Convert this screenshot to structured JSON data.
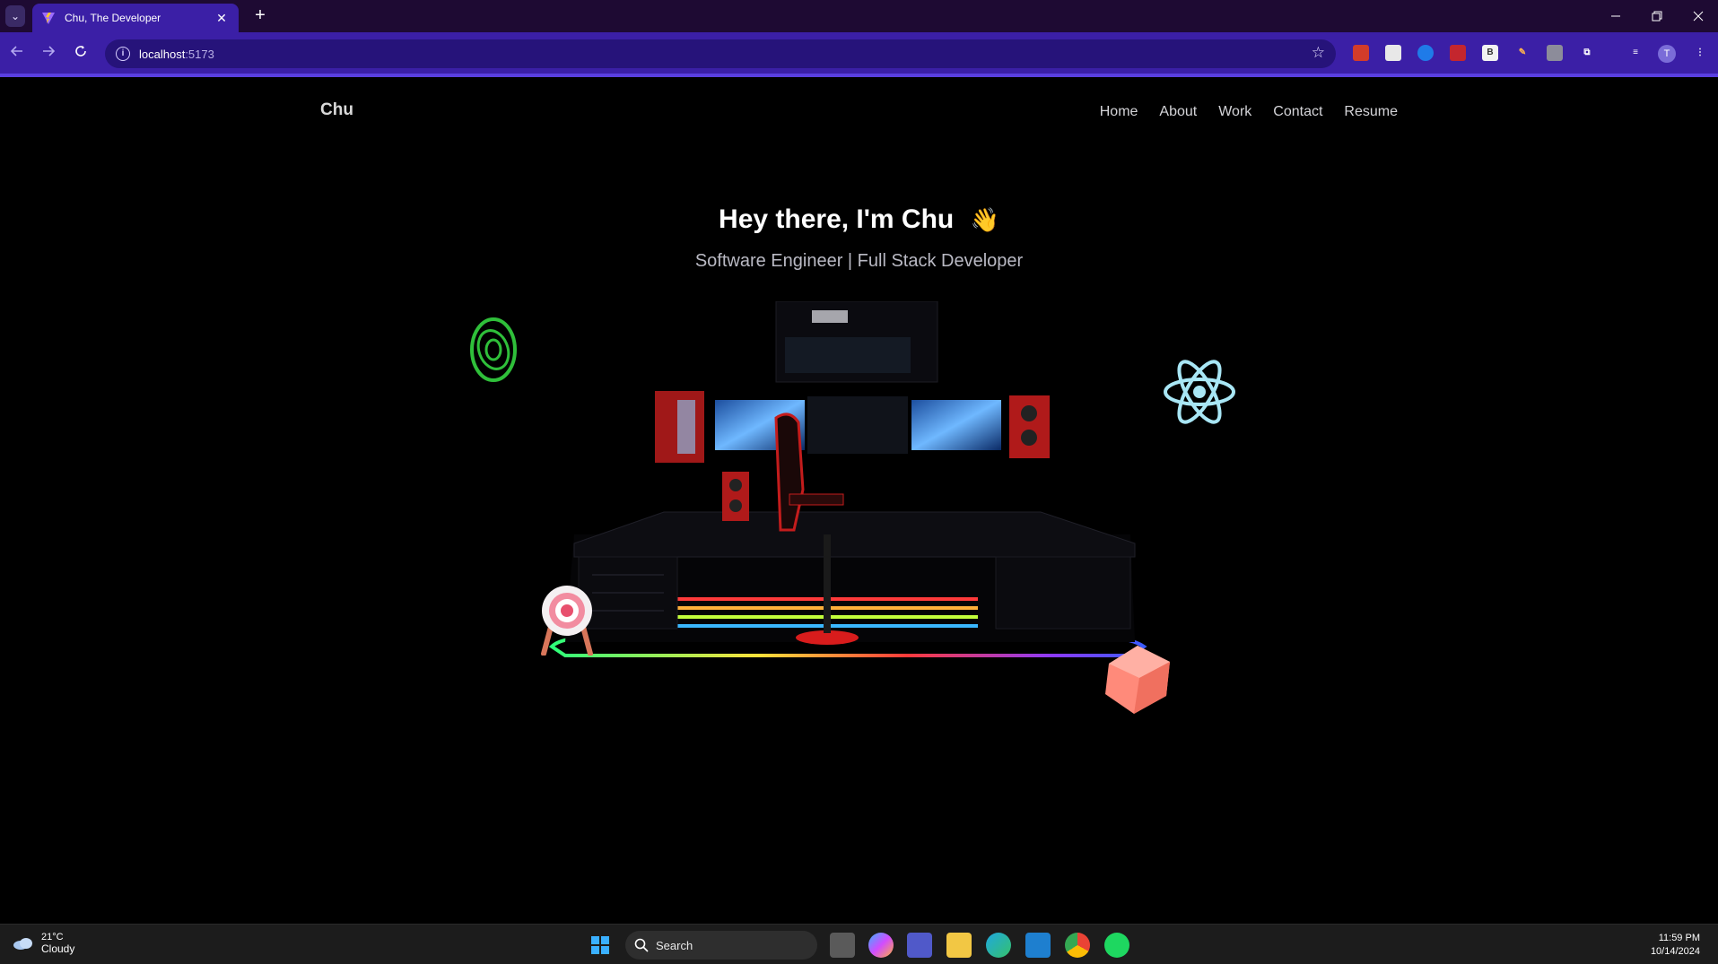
{
  "browser": {
    "tab_title": "Chu, The Developer",
    "url_host": "localhost",
    "url_port": ":5173",
    "close_glyph": "✕",
    "new_tab_glyph": "+"
  },
  "site": {
    "logo": "Chu",
    "nav": [
      "Home",
      "About",
      "Work",
      "Contact",
      "Resume"
    ],
    "hero_title": "Hey there, I'm Chu",
    "hero_wave": "👋",
    "hero_subtitle": "Software Engineer | Full Stack Developer"
  },
  "taskbar": {
    "temperature": "21°C",
    "condition": "Cloudy",
    "search_label": "Search",
    "time": "11:59 PM",
    "date": "10/14/2024"
  },
  "colors": {
    "tabbar_bg": "#1e0a33",
    "toolbar_bg": "#3b1fa6",
    "page_bg": "#000000",
    "react_icon": "#a8e6f5",
    "ring_icon": "#2fbf3a",
    "cube": "#ff8a7a"
  }
}
